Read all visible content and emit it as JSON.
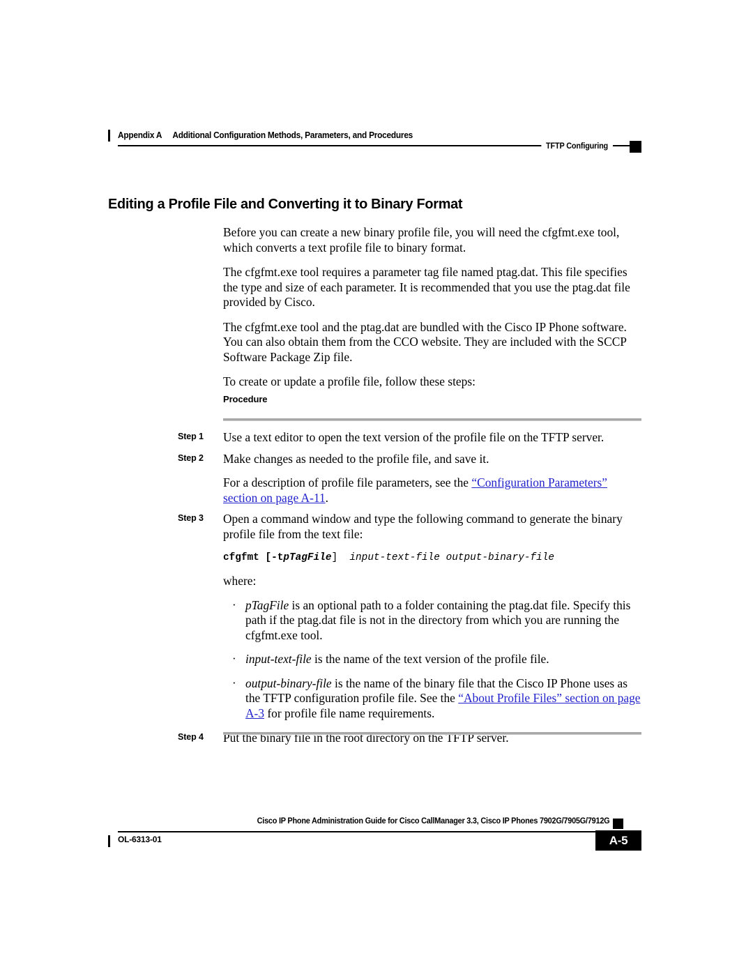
{
  "header": {
    "appendix": "Appendix A",
    "chapter_title": "Additional Configuration Methods, Parameters, and Procedures",
    "section": "TFTP Configuring"
  },
  "page": {
    "title": "Editing a Profile File and Converting it to Binary Format",
    "paragraphs": [
      "Before you can create a new binary profile file, you will need the cfgfmt.exe tool, which converts a text profile file to binary format.",
      "The cfgfmt.exe tool requires a parameter tag file named ptag.dat. This file specifies the type and size of each parameter. It is recommended that you use the ptag.dat file provided by Cisco.",
      "The cfgfmt.exe tool and the ptag.dat are bundled with the Cisco IP Phone software. You can also obtain them from the CCO website. They are included with the SCCP Software Package Zip file.",
      "To create or update a profile file, follow these steps:"
    ],
    "procedure_heading": "Procedure"
  },
  "steps": [
    {
      "label": "Step 1",
      "text": "Use a text editor to open the text version of the profile file on the TFTP server."
    },
    {
      "label": "Step 2",
      "text": "Make changes as needed to the profile file, and save it.",
      "note_before_link": "For a description of profile file parameters, see the ",
      "note_link": "“Configuration Parameters” section on page A-11",
      "note_after_link": "."
    },
    {
      "label": "Step 3",
      "text": "Open a command window and type the following command to generate the binary profile file from the text file:",
      "command": {
        "name": "cfgfmt",
        "option_open": "[-t",
        "option_arg": "pTagFile",
        "option_close": "]",
        "args": "input-text-file output-binary-file"
      },
      "where_label": "where:",
      "bullets": [
        {
          "term": "pTagFile",
          "text": " is an optional path to a folder containing the ptag.dat file. Specify this path if the ptag.dat file is not in the directory from which you are running the cfgfmt.exe tool."
        },
        {
          "term": "input-text-file",
          "text": " is the name of the text version of the profile file."
        },
        {
          "term": "output-binary-file",
          "text_before_link": " is the name of the binary file that the Cisco IP Phone uses as the TFTP configuration profile file. See the ",
          "link": "“About Profile Files” section on page A-3",
          "text_after_link": " for profile file name requirements."
        }
      ]
    },
    {
      "label": "Step 4",
      "text": "Put the binary file in the root directory on the TFTP server."
    }
  ],
  "footer": {
    "guide_title": "Cisco IP Phone Administration Guide for Cisco CallManager 3.3, Cisco IP Phones 7902G/7905G/7912G",
    "doc_id": "OL-6313-01",
    "page_number": "A-5"
  },
  "colors": {
    "link": "#2222cc",
    "rule_gray": "#a8a8a8",
    "marker_black": "#000000"
  }
}
